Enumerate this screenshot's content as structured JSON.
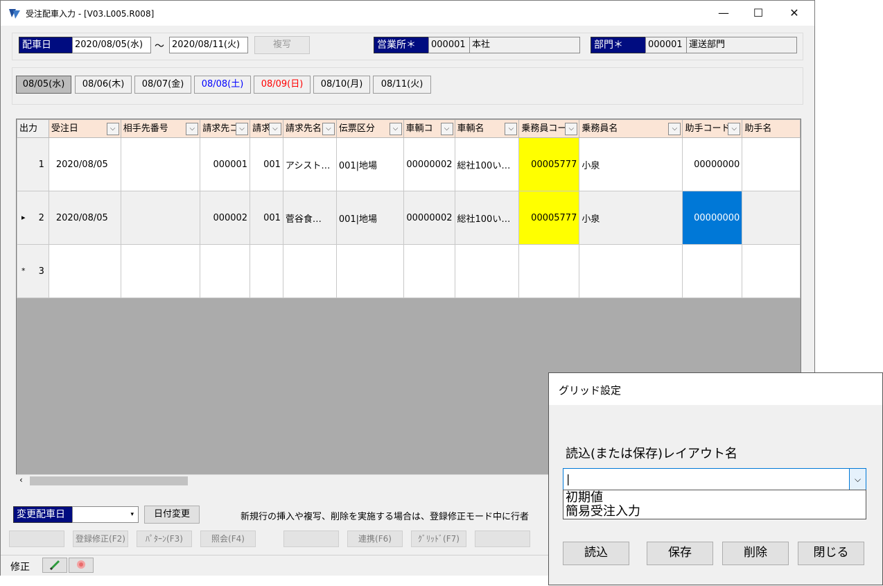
{
  "window": {
    "title": "受注配車入力 - [V03.L005.R008]",
    "minimize": "—",
    "maximize": "☐",
    "close": "✕"
  },
  "header": {
    "date_label": "配車日",
    "date_from": "2020/08/05(水)",
    "tilde": "～",
    "date_to": "2020/08/11(火)",
    "copy_button": "複写",
    "office_label": "営業所＊",
    "office_code": "000001",
    "office_name": "本社",
    "dept_label": "部門＊",
    "dept_code": "000001",
    "dept_name": "運送部門"
  },
  "day_tabs": [
    {
      "label": "08/05(水)",
      "color": "#000000"
    },
    {
      "label": "08/06(木)",
      "color": "#000000"
    },
    {
      "label": "08/07(金)",
      "color": "#000000"
    },
    {
      "label": "08/08(土)",
      "color": "#0000ff"
    },
    {
      "label": "08/09(日)",
      "color": "#ff0000"
    },
    {
      "label": "08/10(月)",
      "color": "#000000"
    },
    {
      "label": "08/11(火)",
      "color": "#000000"
    }
  ],
  "grid": {
    "columns": [
      "出力",
      "受注日",
      "相手先番号",
      "請求先コ",
      "請求",
      "請求先名",
      "伝票区分",
      "車輌コ",
      "車輌名",
      "乗務員コード",
      "乗務員名",
      "助手コード",
      "助手名"
    ],
    "rows": [
      {
        "marker": "",
        "no": "1",
        "order_date": "2020/08/05",
        "partner_no": "",
        "bill_code": "000001",
        "bill_sub": "001",
        "bill_name": "アシスト…",
        "slip_type": "001|地場",
        "vehicle_code": "00000002",
        "vehicle_name": "総社100い…",
        "driver_code": "00005777",
        "driver_name": "小泉",
        "assistant_code": "00000000",
        "assistant_name": ""
      },
      {
        "marker": "▸",
        "no": "2",
        "order_date": "2020/08/05",
        "partner_no": "",
        "bill_code": "000002",
        "bill_sub": "001",
        "bill_name": "菅谷食…",
        "slip_type": "001|地場",
        "vehicle_code": "00000002",
        "vehicle_name": "総社100い…",
        "driver_code": "00005777",
        "driver_name": "小泉",
        "assistant_code": "00000000",
        "assistant_name": ""
      },
      {
        "marker": "*",
        "no": "3",
        "order_date": "",
        "partner_no": "",
        "bill_code": "",
        "bill_sub": "",
        "bill_name": "",
        "slip_type": "",
        "vehicle_code": "",
        "vehicle_name": "",
        "driver_code": "",
        "driver_name": "",
        "assistant_code": "",
        "assistant_name": ""
      }
    ]
  },
  "bottom": {
    "change_date_label": "変更配車日",
    "date_change_button": "日付変更",
    "notice": "新規行の挿入や複写、削除を実施する場合は、登録修正モード中に行者",
    "f2": "登録修正(F2)",
    "f3": "ﾊﾟﾀｰﾝ(F3)",
    "f4": "照会(F4)",
    "f6": "連携(F6)",
    "f7": "ｸﾞﾘｯﾄﾞ(F7)",
    "mode": "修正"
  },
  "dialog": {
    "title": "グリッド設定",
    "layout_label": "読込(または保存)レイアウト名",
    "input_value": "|",
    "options": [
      "初期値",
      "簡易受注入力"
    ],
    "buttons": {
      "load": "読込",
      "save": "保存",
      "delete": "削除",
      "close": "閉じる"
    }
  }
}
